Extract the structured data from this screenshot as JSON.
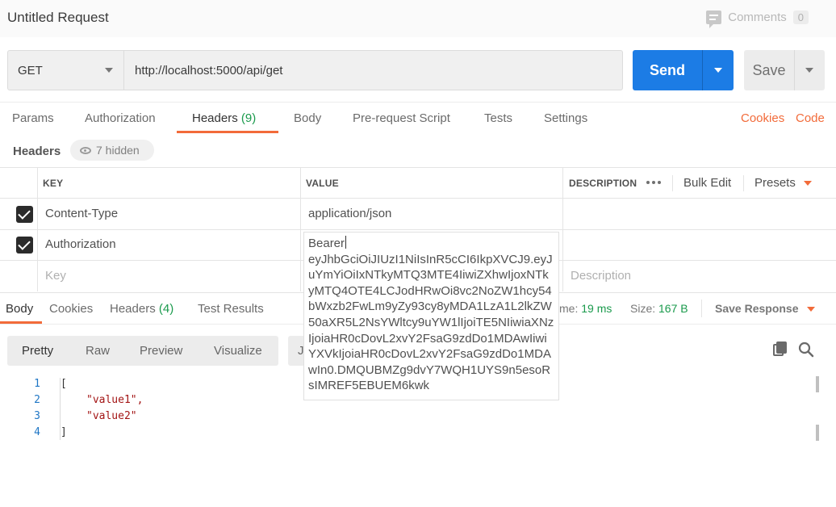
{
  "titlebar": {
    "title": "Untitled Request",
    "comments_label": "Comments",
    "comments_count": "0"
  },
  "request": {
    "method": "GET",
    "url": "http://localhost:5000/api/get",
    "send_label": "Send",
    "save_label": "Save"
  },
  "request_tabs": [
    {
      "label": "Params"
    },
    {
      "label": "Authorization"
    },
    {
      "label": "Headers",
      "count": "(9)"
    },
    {
      "label": "Body"
    },
    {
      "label": "Pre-request Script"
    },
    {
      "label": "Tests"
    },
    {
      "label": "Settings"
    }
  ],
  "request_links": {
    "cookies": "Cookies",
    "code": "Code"
  },
  "headers_section": {
    "title": "Headers",
    "hidden_label": "7 hidden",
    "columns": {
      "key": "KEY",
      "value": "VALUE",
      "description": "DESCRIPTION"
    },
    "bulk_edit": "Bulk Edit",
    "presets": "Presets",
    "rows": [
      {
        "key": "Content-Type",
        "value": "application/json",
        "checked": true
      },
      {
        "key": "Authorization",
        "value": "Bearer",
        "checked": true
      }
    ],
    "placeholder_key": "Key",
    "placeholder_description": "Description",
    "auth_value_expanded": "Bearer",
    "auth_value_token": "eyJhbGciOiJIUzI1NiIsInR5cCI6IkpXVCJ9.eyJuYmYiOiIxNTkyMTQ3MTE4IiwiZXhwIjoxNTkyMTQ4OTE4LCJodHRwOi8vc2NoZW1hcy54bWxzb2FwLm9yZy93cy8yMDA1LzA1L2lkZW50aXR5L2NsYWltcy9uYW1lIjoiTE5NIiwiaXNzIjoiaHR0cDovL2xvY2FsaG9zdDo1MDAwIiwiYXVkIjoiaHR0cDovL2xvY2FsaG9zdDo1MDAwIn0.DMQUBMZg9dvY7WQH1UYS9n5esoRsIMREF5EBUEM6kwk"
  },
  "response_tabs": [
    {
      "label": "Body"
    },
    {
      "label": "Cookies"
    },
    {
      "label": "Headers",
      "count": "(4)"
    },
    {
      "label": "Test Results"
    }
  ],
  "response_meta": {
    "time_label_partial": "me:",
    "time_value": "19 ms",
    "size_label": "Size:",
    "size_value": "167 B",
    "save_response": "Save Response"
  },
  "viewer": {
    "modes": [
      "Pretty",
      "Raw",
      "Preview",
      "Visualize"
    ],
    "format_partial": "J"
  },
  "code": {
    "line_numbers": [
      "1",
      "2",
      "3",
      "4"
    ],
    "lines": [
      "[",
      "\"value1\",",
      "\"value2\"",
      "]"
    ]
  },
  "colors": {
    "accent": "#f26b3a",
    "send_blue": "#1c7ce5",
    "count_green": "#1a9a4c"
  }
}
